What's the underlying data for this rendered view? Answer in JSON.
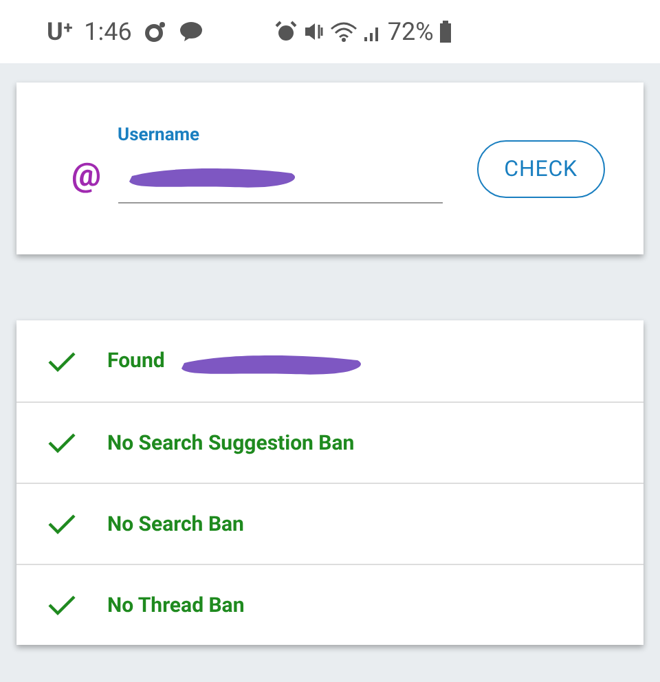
{
  "status_bar": {
    "carrier": "U⁺",
    "time": "1:46",
    "battery": "72%"
  },
  "search": {
    "label": "Username",
    "prefix": "@",
    "button": "CHECK"
  },
  "results": [
    {
      "label": "Found",
      "passed": true,
      "redacted": true
    },
    {
      "label": "No Search Suggestion Ban",
      "passed": true,
      "redacted": false
    },
    {
      "label": "No Search Ban",
      "passed": true,
      "redacted": false
    },
    {
      "label": "No Thread Ban",
      "passed": true,
      "redacted": false
    }
  ]
}
